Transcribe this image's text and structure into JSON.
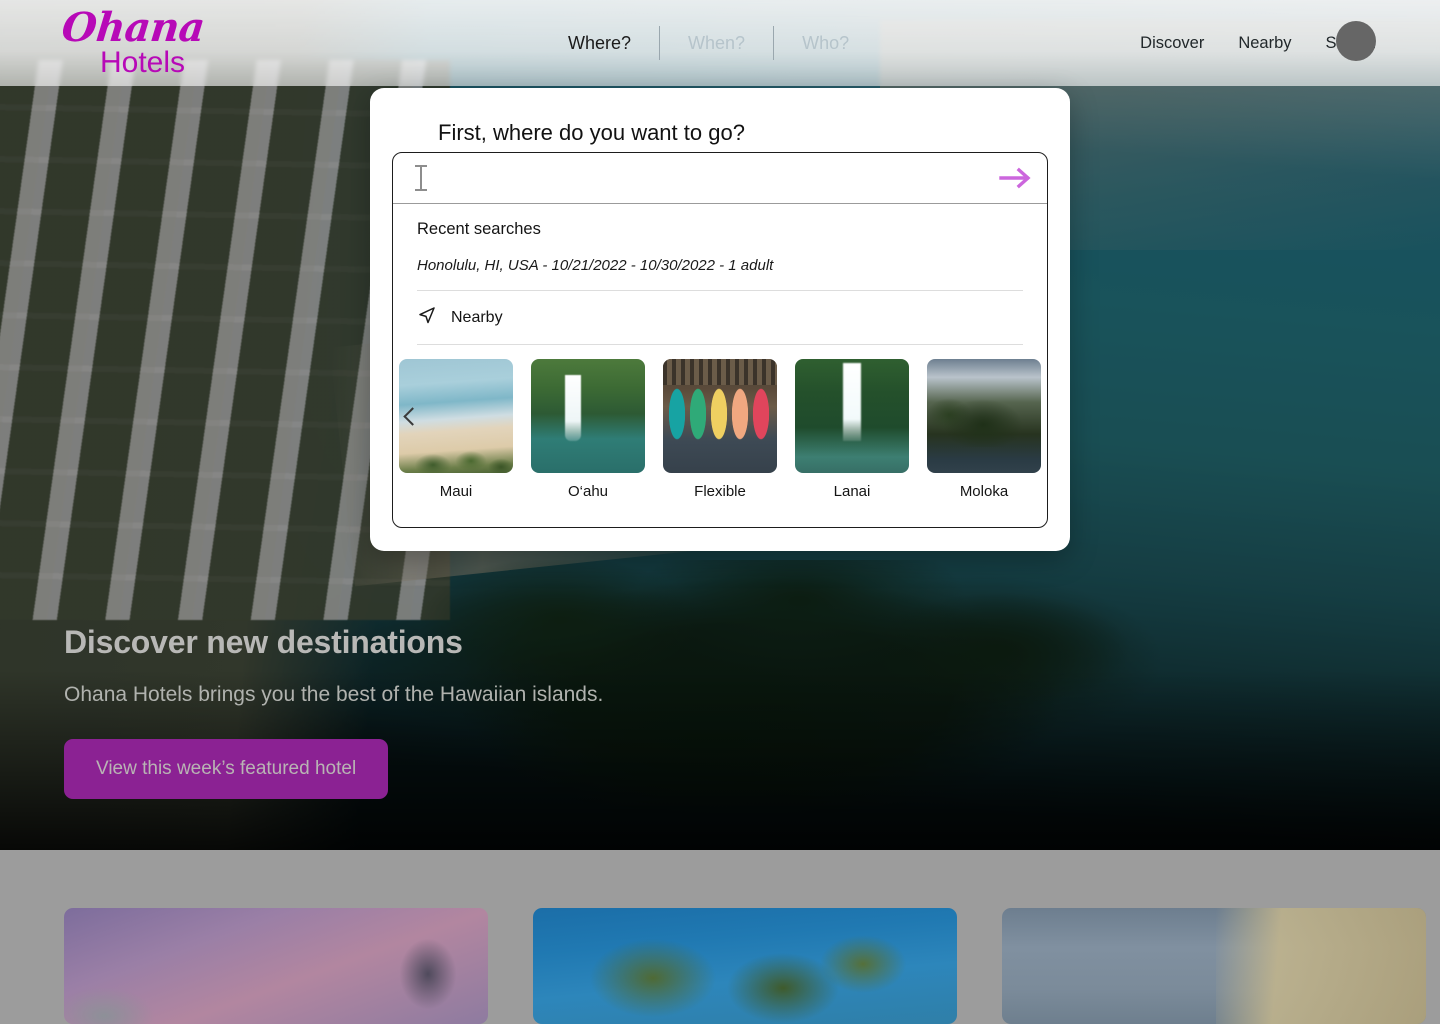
{
  "header": {
    "logo": {
      "script": "Ohana",
      "sub": "Hotels"
    },
    "search_tabs": [
      {
        "label": "Where?",
        "active": true
      },
      {
        "label": "When?",
        "active": false
      },
      {
        "label": "Who?",
        "active": false
      }
    ],
    "nav_links": [
      "Discover",
      "Nearby",
      "Sign in"
    ],
    "avatar": "avatar-placeholder"
  },
  "modal": {
    "title": "First, where do you want to go?",
    "search": {
      "value": "",
      "placeholder": "",
      "submit_icon": "arrow-right-icon",
      "cursor_icon": "text-cursor-icon"
    },
    "recent": {
      "title": "Recent searches",
      "items": [
        "Honolulu, HI, USA - 10/21/2022 - 10/30/2022 - 1 adult"
      ]
    },
    "nearby": {
      "label": "Nearby",
      "icon": "navigation-arrow-icon"
    },
    "carousel": {
      "prev_icon": "chevron-left-icon",
      "destinations": [
        {
          "label": "Maui",
          "image": "maui-beach-aerial"
        },
        {
          "label": "O‘ahu",
          "image": "oahu-waterfall"
        },
        {
          "label": "Flexible",
          "image": "aloha-surfboards"
        },
        {
          "label": "Lanai",
          "image": "lanai-waterfall"
        },
        {
          "label": "Moloka",
          "image": "molokai-cliffs"
        }
      ]
    }
  },
  "hero": {
    "heading": "Discover new destinations",
    "subheading": "Ohana Hotels brings you the best of the Hawaiian islands.",
    "cta_label": "View this week’s featured hotel"
  },
  "lower_section": {
    "cards": [
      {
        "image": "sunset-palms-card"
      },
      {
        "image": "palm-trees-blue-sky-card"
      },
      {
        "image": "hotel-facade-card"
      }
    ]
  },
  "colors": {
    "brand_magenta": "#b709b7",
    "cta_purple": "#8b2293",
    "arrow_orchid": "#cc66dd",
    "avatar_gray": "#666666",
    "muted_tab": "#b6c4cb"
  }
}
